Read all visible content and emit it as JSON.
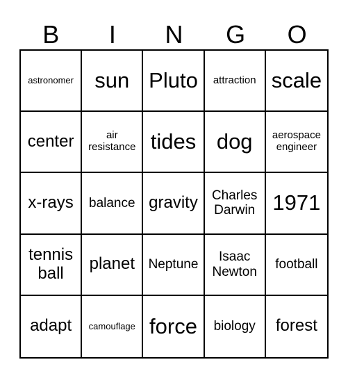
{
  "card": {
    "header": [
      "B",
      "I",
      "N",
      "G",
      "O"
    ],
    "cells": [
      [
        {
          "text": "astronomer",
          "size": "s-xs"
        },
        {
          "text": "sun",
          "size": "s-xl"
        },
        {
          "text": "Pluto",
          "size": "s-xl"
        },
        {
          "text": "attraction",
          "size": "s-sm"
        },
        {
          "text": "scale",
          "size": "s-xl"
        }
      ],
      [
        {
          "text": "center",
          "size": "s-lg"
        },
        {
          "text": "air resistance",
          "size": "s-sm"
        },
        {
          "text": "tides",
          "size": "s-xl"
        },
        {
          "text": "dog",
          "size": "s-xl"
        },
        {
          "text": "aerospace engineer",
          "size": "s-sm"
        }
      ],
      [
        {
          "text": "x-rays",
          "size": "s-lg"
        },
        {
          "text": "balance",
          "size": "s-md"
        },
        {
          "text": "gravity",
          "size": "s-lg"
        },
        {
          "text": "Charles Darwin",
          "size": "s-md"
        },
        {
          "text": "1971",
          "size": "s-xl"
        }
      ],
      [
        {
          "text": "tennis ball",
          "size": "s-lg"
        },
        {
          "text": "planet",
          "size": "s-lg"
        },
        {
          "text": "Neptune",
          "size": "s-md"
        },
        {
          "text": "Isaac Newton",
          "size": "s-md"
        },
        {
          "text": "football",
          "size": "s-md"
        }
      ],
      [
        {
          "text": "adapt",
          "size": "s-lg"
        },
        {
          "text": "camouflage",
          "size": "s-xs"
        },
        {
          "text": "force",
          "size": "s-xl"
        },
        {
          "text": "biology",
          "size": "s-md"
        },
        {
          "text": "forest",
          "size": "s-lg"
        }
      ]
    ]
  }
}
